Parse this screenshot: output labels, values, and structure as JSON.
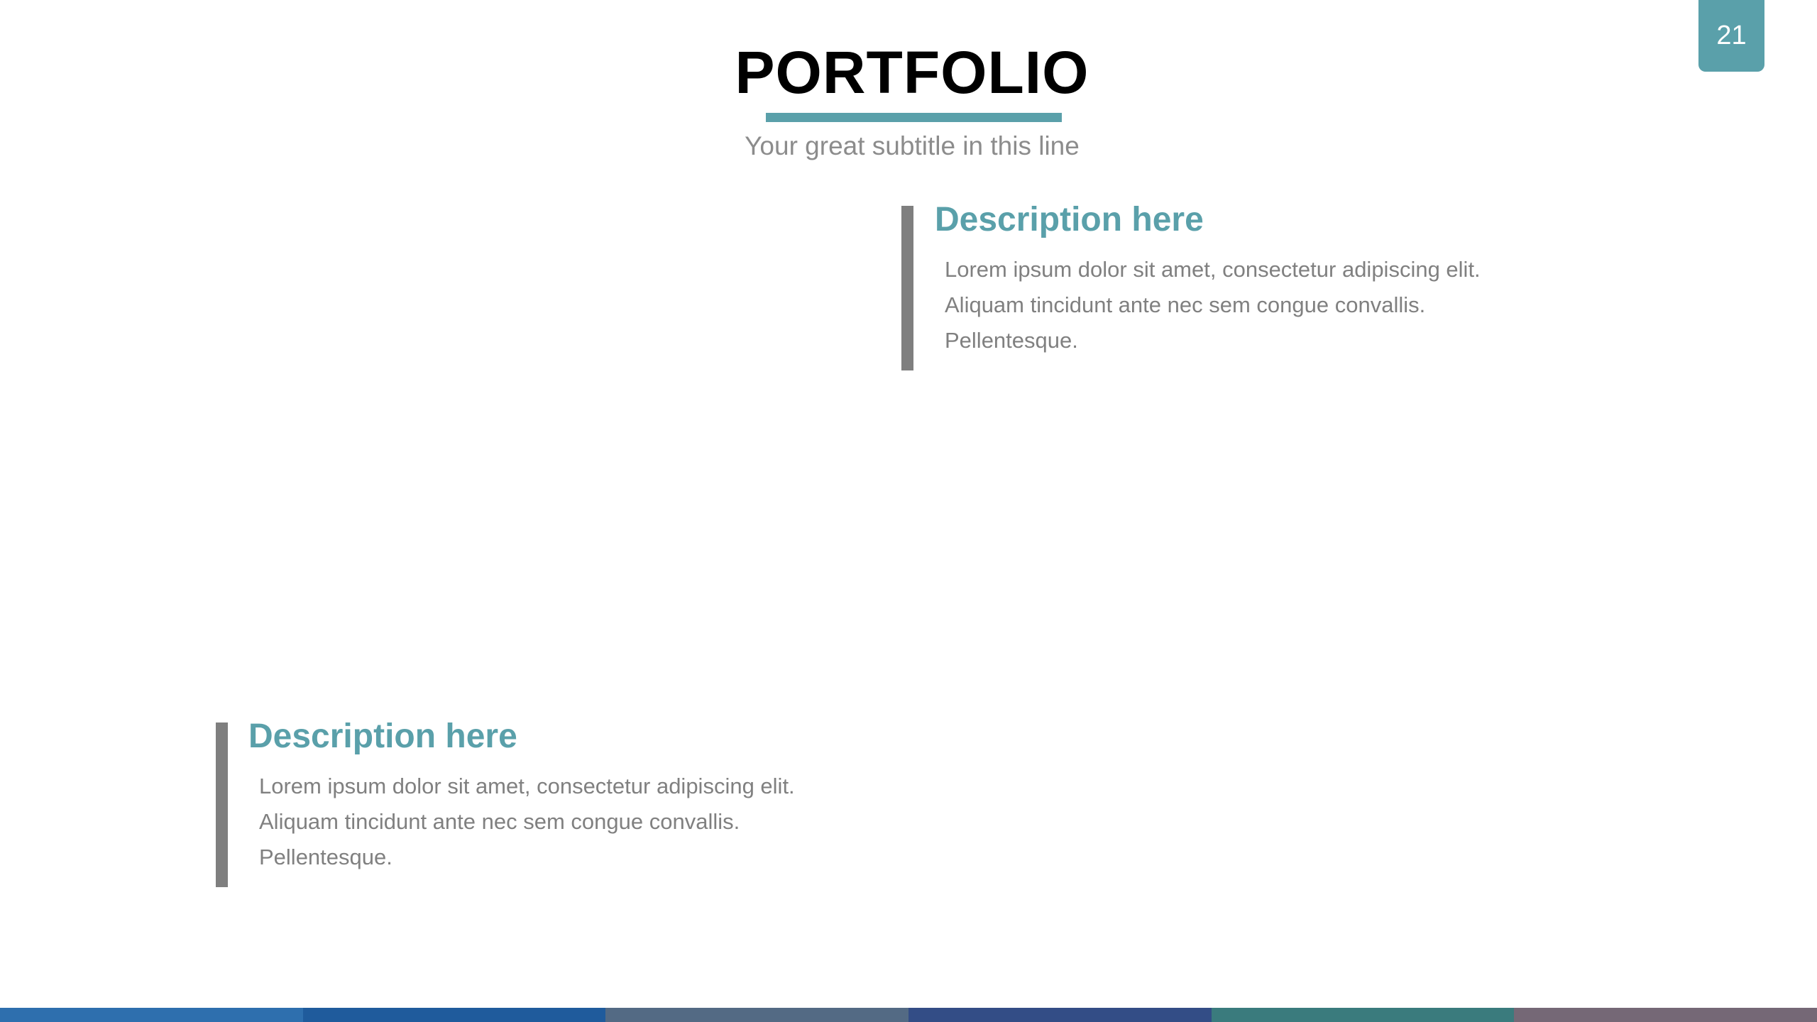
{
  "slide": {
    "page_number": "21",
    "title": "PORTFOLIO",
    "subtitle": "Your great subtitle in this line"
  },
  "descriptions": [
    {
      "heading": "Description here",
      "lines": [
        "Lorem ipsum dolor sit amet, consectetur adipiscing elit.",
        "Aliquam tincidunt ante nec sem congue convallis.",
        "Pellentesque."
      ]
    },
    {
      "heading": "Description here",
      "lines": [
        "Lorem ipsum dolor sit amet, consectetur adipiscing elit.",
        "Aliquam tincidunt ante nec sem congue convallis.",
        "Pellentesque."
      ]
    }
  ],
  "colors": {
    "accent": "#5aa0aa",
    "bar_gray": "#7f7f7f",
    "bottom_segments": [
      "#2e6fae",
      "#1f5b9c",
      "#536a84",
      "#334d86",
      "#3a7b7d",
      "#756876"
    ]
  }
}
